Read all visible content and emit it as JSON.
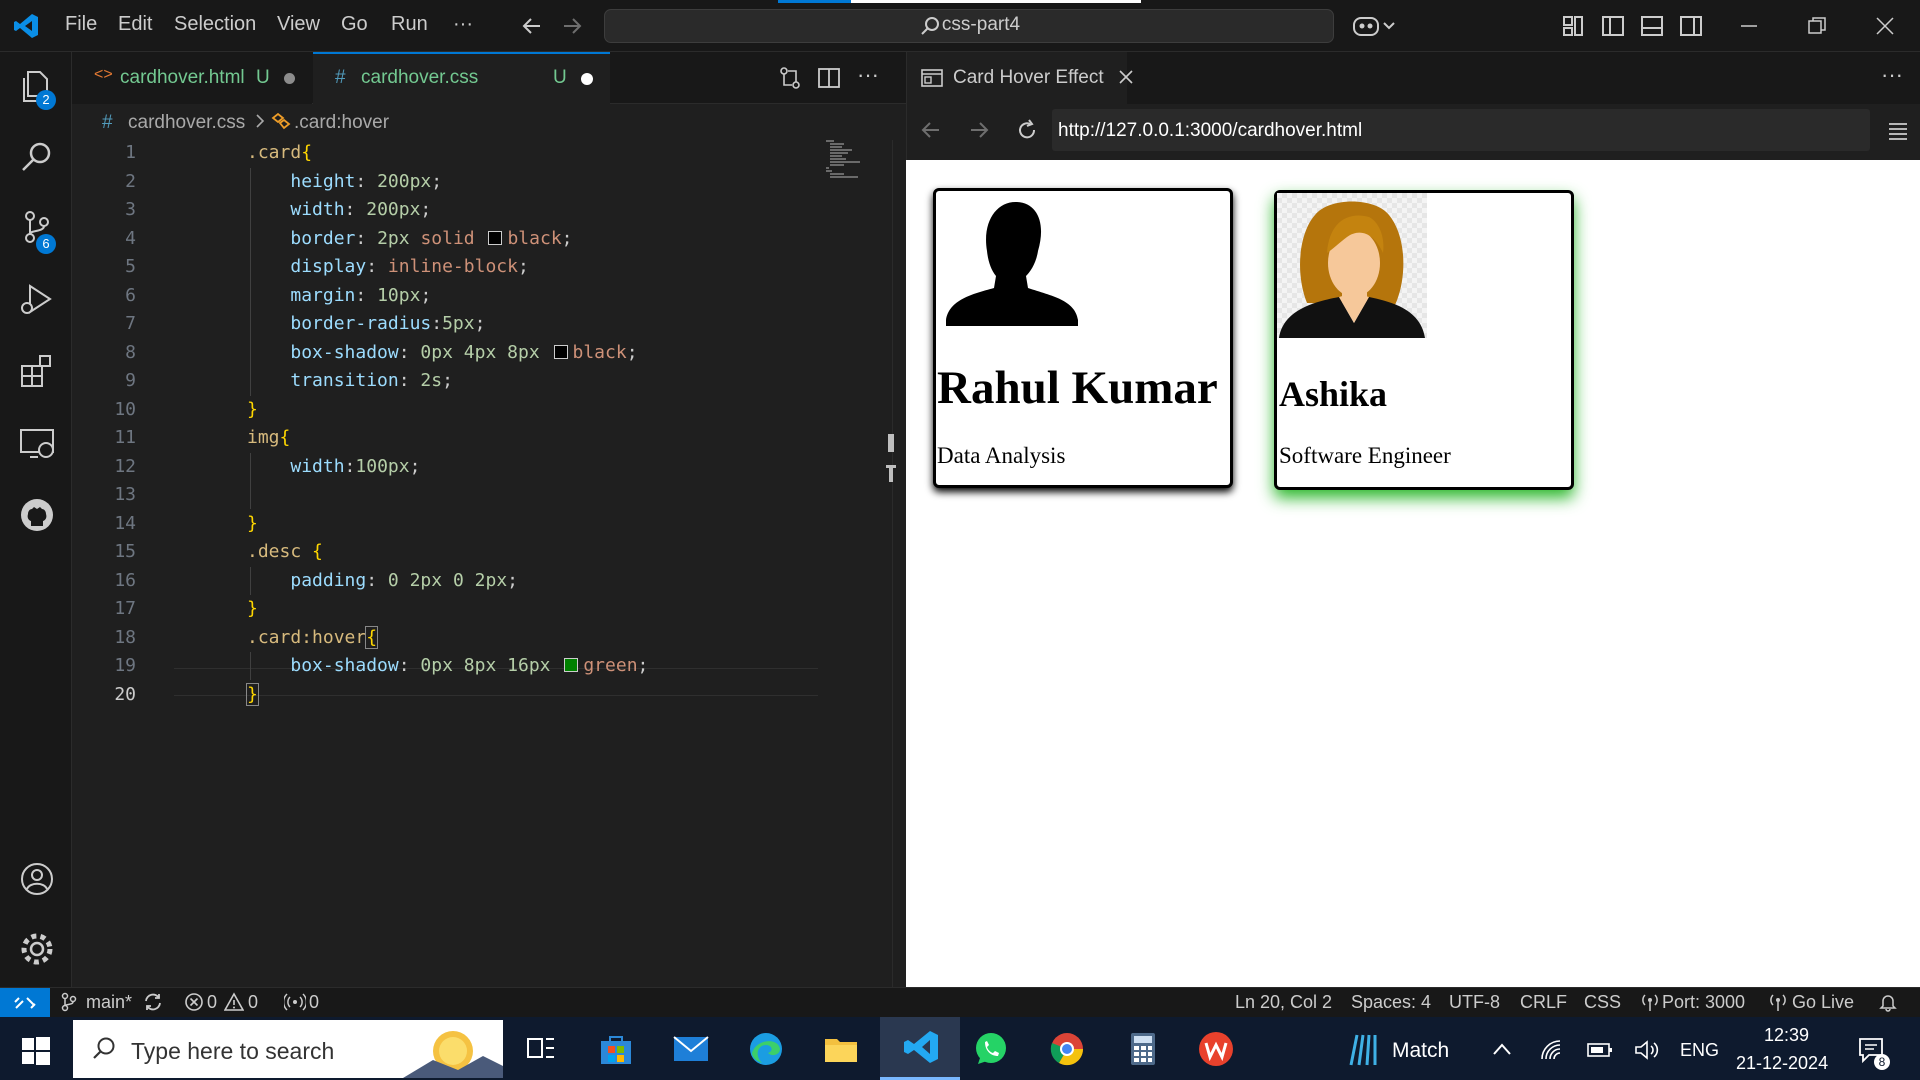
{
  "titlebar": {
    "menus": [
      "File",
      "Edit",
      "Selection",
      "View",
      "Go",
      "Run",
      "···"
    ],
    "search": "css-part4"
  },
  "activity": {
    "explorer_badge": "2",
    "scm_badge": "6"
  },
  "editor": {
    "tabs": [
      {
        "name": "cardhover.html",
        "status": "U"
      },
      {
        "name": "cardhover.css",
        "status": "U"
      }
    ],
    "breadcrumb": {
      "file": "cardhover.css",
      "symbol": ".card:hover"
    },
    "line_numbers": [
      "1",
      "2",
      "3",
      "4",
      "5",
      "6",
      "7",
      "8",
      "9",
      "10",
      "11",
      "12",
      "13",
      "14",
      "15",
      "16",
      "17",
      "18",
      "19",
      "20"
    ]
  },
  "preview": {
    "tab_title": "Card Hover Effect",
    "url": "http://127.0.0.1:3000/cardhover.html",
    "cards": [
      {
        "name": "Rahul Kumar",
        "role": "Data Analysis"
      },
      {
        "name": "Ashika",
        "role": "Software Engineer"
      }
    ]
  },
  "statusbar": {
    "branch": "main*",
    "errors": "0",
    "warnings": "0",
    "ports": "0",
    "position": "Ln 20, Col 2",
    "spaces": "Spaces: 4",
    "encoding": "UTF-8",
    "eol": "CRLF",
    "language": "CSS",
    "port": "Port: 3000",
    "golive": "Go Live"
  },
  "taskbar": {
    "search_placeholder": "Type here to search",
    "weather": "Match",
    "lang": "ENG",
    "time": "12:39",
    "date": "21-12-2024",
    "notifications": "8"
  },
  "colors": {
    "accent": "#0078d4",
    "hover_glow": "#2db82d"
  }
}
